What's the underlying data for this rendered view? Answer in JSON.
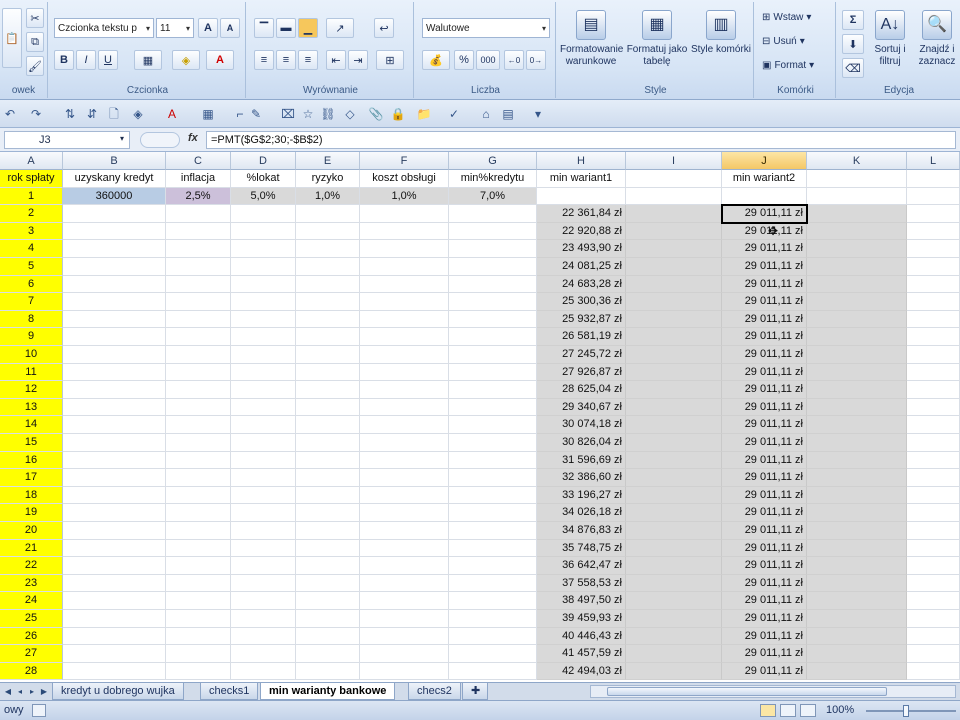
{
  "ribbon": {
    "clipboard": {
      "label": "owek"
    },
    "font": {
      "name": "Czcionka tekstu p",
      "size": "11",
      "label": "Czcionka"
    },
    "alignment": {
      "label": "Wyrównanie"
    },
    "number": {
      "format": "Walutowe",
      "label": "Liczba",
      "percent": "%",
      "thousands": "000"
    },
    "styles": {
      "label": "Style",
      "conditional": "Formatowanie warunkowe",
      "as_table": "Formatuj jako tabelę",
      "cell_styles": "Style komórki"
    },
    "cells": {
      "label": "Komórki",
      "insert": "Wstaw",
      "delete": "Usuń",
      "format": "Format"
    },
    "editing": {
      "label": "Edycja",
      "sort": "Sortuj i filtruj",
      "find": "Znajdź i zaznacz"
    }
  },
  "formula_bar": {
    "name_box": "J3",
    "fx": "fx",
    "formula": "=PMT($G$2;30;-$B$2)"
  },
  "columns": [
    "A",
    "B",
    "C",
    "D",
    "E",
    "F",
    "G",
    "H",
    "I",
    "J",
    "K",
    "L"
  ],
  "header_row": [
    "rok spłaty",
    "uzyskany kredyt",
    "inflacja",
    "%lokat",
    "ryzyko",
    "koszt obsługi",
    "min%kredytu",
    "min wariant1",
    "",
    "min wariant2",
    "",
    ""
  ],
  "first_row": [
    "1",
    "360000",
    "2,5%",
    "5,0%",
    "1,0%",
    "1,0%",
    "7,0%",
    "",
    "",
    "",
    "",
    ""
  ],
  "row_labels": [
    "2",
    "3",
    "4",
    "5",
    "6",
    "7",
    "8",
    "9",
    "10",
    "11",
    "12",
    "13",
    "14",
    "15",
    "16",
    "17",
    "18",
    "19",
    "20",
    "21",
    "22",
    "23",
    "24",
    "25",
    "26",
    "27",
    "28"
  ],
  "wariant1": [
    "22 361,84 zł",
    "22 920,88 zł",
    "23 493,90 zł",
    "24 081,25 zł",
    "24 683,28 zł",
    "25 300,36 zł",
    "25 932,87 zł",
    "26 581,19 zł",
    "27 245,72 zł",
    "27 926,87 zł",
    "28 625,04 zł",
    "29 340,67 zł",
    "30 074,18 zł",
    "30 826,04 zł",
    "31 596,69 zł",
    "32 386,60 zł",
    "33 196,27 zł",
    "34 026,18 zł",
    "34 876,83 zł",
    "35 748,75 zł",
    "36 642,47 zł",
    "37 558,53 zł",
    "38 497,50 zł",
    "39 459,93 zł",
    "40 446,43 zł",
    "41 457,59 zł",
    "42 494,03 zł"
  ],
  "wariant2": [
    "29 011,11 zł",
    "29 011,11 zł",
    "29 011,11 zł",
    "29 011,11 zł",
    "29 011,11 zł",
    "29 011,11 zł",
    "29 011,11 zł",
    "29 011,11 zł",
    "29 011,11 zł",
    "29 011,11 zł",
    "29 011,11 zł",
    "29 011,11 zł",
    "29 011,11 zł",
    "29 011,11 zł",
    "29 011,11 zł",
    "29 011,11 zł",
    "29 011,11 zł",
    "29 011,11 zł",
    "29 011,11 zł",
    "29 011,11 zł",
    "29 011,11 zł",
    "29 011,11 zł",
    "29 011,11 zł",
    "29 011,11 zł",
    "29 011,11 zł",
    "29 011,11 zł",
    "29 011,11 zł"
  ],
  "sheet_tabs": [
    "kredyt u dobrego wujka",
    "checks1",
    "min warianty bankowe",
    "checs2"
  ],
  "active_sheet": "min warianty bankowe",
  "status": {
    "text": "owy",
    "zoom": "100%"
  },
  "colors": {
    "row_header_yellow": "#ffff00",
    "computed_gray": "#d9d9d9",
    "selected_col": "#f4c766"
  }
}
